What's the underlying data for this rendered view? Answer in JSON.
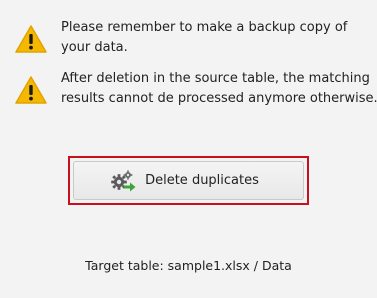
{
  "notices": [
    {
      "icon": "warning-icon",
      "lines": [
        "Please remember to make a backup copy of",
        "your data."
      ]
    },
    {
      "icon": "warning-icon",
      "lines": [
        "After deletion in the source table, the matching",
        "results cannot de processed anymore otherwise."
      ]
    }
  ],
  "actions": {
    "delete_label": "Delete duplicates",
    "delete_icon": "gears-arrow-icon"
  },
  "target_table": {
    "label": "Target table: sample1.xlsx / Data"
  },
  "colors": {
    "warning_fill": "#f5b800",
    "focus_border": "#c8101e",
    "arrow_green": "#3aa53a",
    "background": "#f3f3f3"
  }
}
